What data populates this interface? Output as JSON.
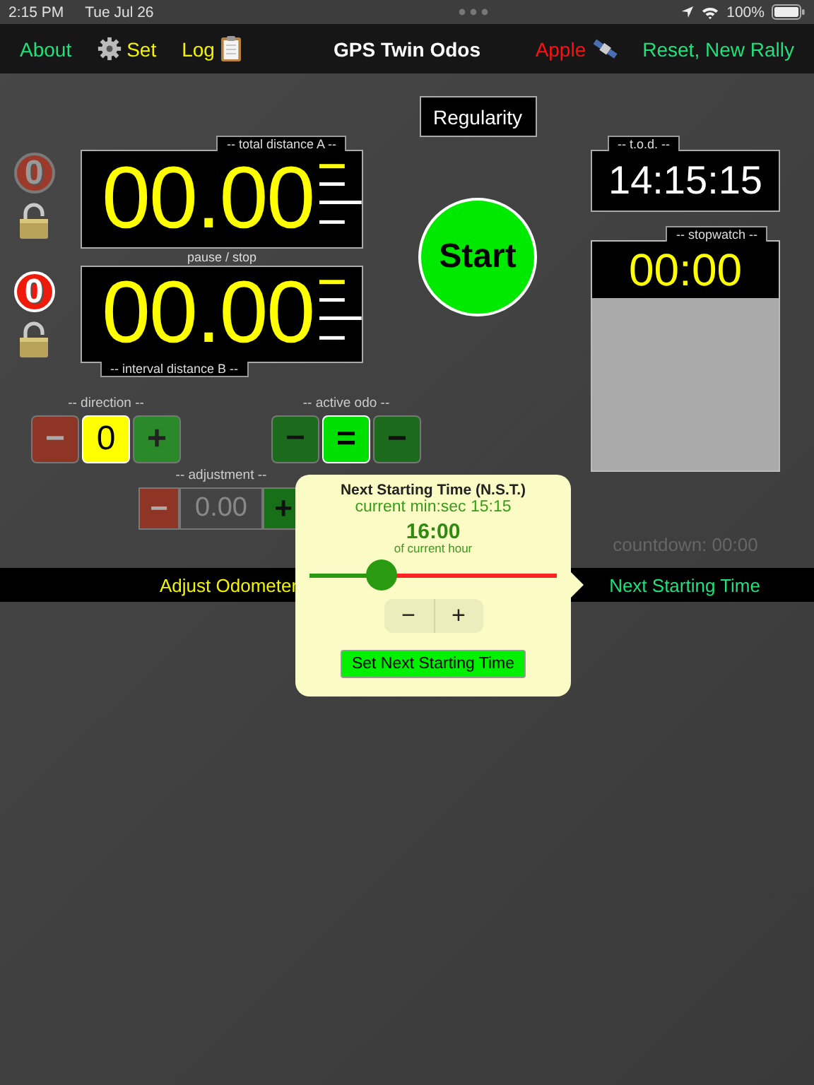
{
  "status_bar": {
    "time": "2:15 PM",
    "date": "Tue Jul 26",
    "battery": "100%"
  },
  "nav": {
    "left": [
      {
        "label": "About",
        "kind": "link"
      },
      {
        "label": "Set",
        "kind": "settings"
      },
      {
        "label": "Log",
        "kind": "log"
      }
    ],
    "title": "GPS Twin Odos",
    "right": [
      {
        "label": "Apple",
        "kind": "gps"
      },
      {
        "label": "Reset, New Rally",
        "kind": "link"
      }
    ]
  },
  "odometers": [
    {
      "label": "-- total distance A --",
      "value": "00.00",
      "reset": "0",
      "active": false
    },
    {
      "label": "-- interval distance B --",
      "value": "00.00",
      "reset": "0",
      "active": true
    }
  ],
  "pause_label": "pause / stop",
  "mode_button": "Regularity",
  "start_button": "Start",
  "tod": {
    "label": "-- t.o.d. --",
    "value": "14:15:15"
  },
  "stopwatch": {
    "label": "-- stopwatch --",
    "value": "00:00"
  },
  "direction": {
    "label": "-- direction --",
    "buttons": [
      {
        "label": "−",
        "kind": "minus"
      },
      {
        "label": "0",
        "kind": "value"
      },
      {
        "label": "+",
        "kind": "plus"
      }
    ]
  },
  "active_odo": {
    "label": "-- active odo --",
    "buttons": [
      {
        "label": "–",
        "kind": "lower",
        "selected": false
      },
      {
        "label": "=",
        "kind": "both",
        "selected": true
      },
      {
        "label": "−",
        "kind": "upper",
        "selected": false
      }
    ]
  },
  "adjustment": {
    "label": "-- adjustment --",
    "minus": "−",
    "placeholder": "0.00",
    "plus": "+"
  },
  "countdown": "countdown: 00:00",
  "bottom_bar": [
    "Adjust Odometer",
    "Next Starting Time"
  ],
  "popover": {
    "title": "Next Starting Time (N.S.T.)",
    "current": "current min:sec 15:15",
    "time": "16:00",
    "caption": "of current hour",
    "slider": {
      "level": 0.29
    },
    "stepper": [
      "−",
      "+"
    ],
    "button": "Set Next Starting Time"
  }
}
